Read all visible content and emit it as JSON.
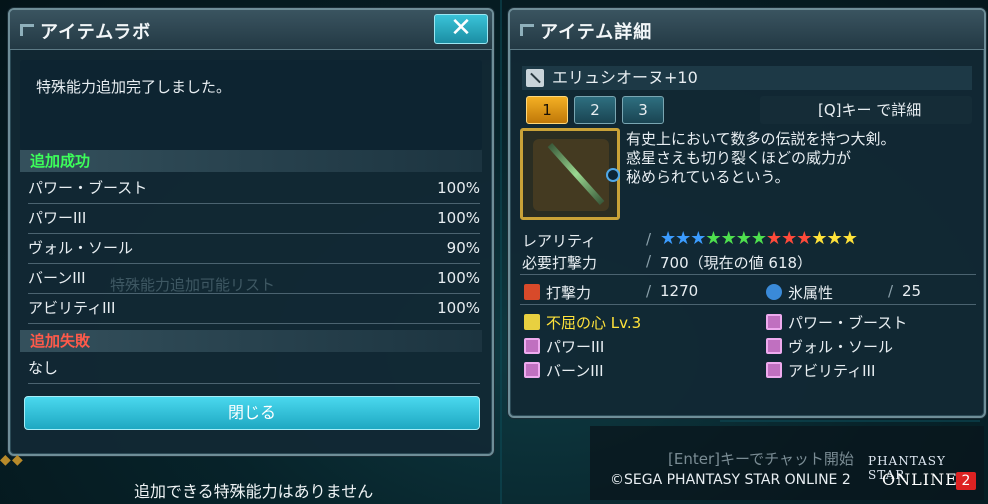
{
  "lab_panel": {
    "title": "アイテムラボ",
    "close_label": "✕",
    "message": "特殊能力追加完了しました。",
    "success_header": "追加成功",
    "success_rows": [
      {
        "name": "パワー・ブースト",
        "pct": "100%"
      },
      {
        "name": "パワーIII",
        "pct": "100%"
      },
      {
        "name": "ヴォル・ソール",
        "pct": "90%"
      },
      {
        "name": "バーンIII",
        "pct": "100%"
      },
      {
        "name": "アビリティIII",
        "pct": "100%"
      }
    ],
    "ghost_text": "特殊能力追加可能リスト",
    "fail_header": "追加失敗",
    "fail_row": "なし",
    "close_button": "閉じる",
    "below_text": "追加できる特殊能力はありません"
  },
  "detail_panel": {
    "title": "アイテム詳細",
    "item_name": "エリュシオーヌ+10",
    "tabs": [
      "1",
      "2",
      "3"
    ],
    "active_tab": 0,
    "detail_button": "[Q]キー で詳細",
    "description": [
      "有史上において数多の伝説を持つ大剣。",
      "惑星さえも切り裂くほどの威力が",
      "秘められているという。"
    ],
    "rarity_label": "レアリティ",
    "rarity_stars": 13,
    "star_colors": [
      "#3b9cff",
      "#3b9cff",
      "#3b9cff",
      "#4ee04e",
      "#4ee04e",
      "#4ee04e",
      "#4ee04e",
      "#ff4a3a",
      "#ff4a3a",
      "#ff4a3a",
      "#ffe23a",
      "#ffe23a",
      "#ffe23a"
    ],
    "req_label": "必要打撃力",
    "req_value": "700（現在の値 618）",
    "atk_label": "打撃力",
    "atk_value": "1270",
    "elem_label": "氷属性",
    "elem_value": "25",
    "special": "不屈の心  Lv.3",
    "abilities": [
      "パワー・ブースト",
      "パワーIII",
      "ヴォル・ソール",
      "バーンIII",
      "アビリティIII"
    ]
  },
  "footer": {
    "enter_hint": "[Enter]キーでチャット開始",
    "copyright": "©SEGA PHANTASY STAR ONLINE 2",
    "logo_line1": "PHANTASY STAR",
    "logo_line2": "ONLINE",
    "logo_num": "2"
  }
}
